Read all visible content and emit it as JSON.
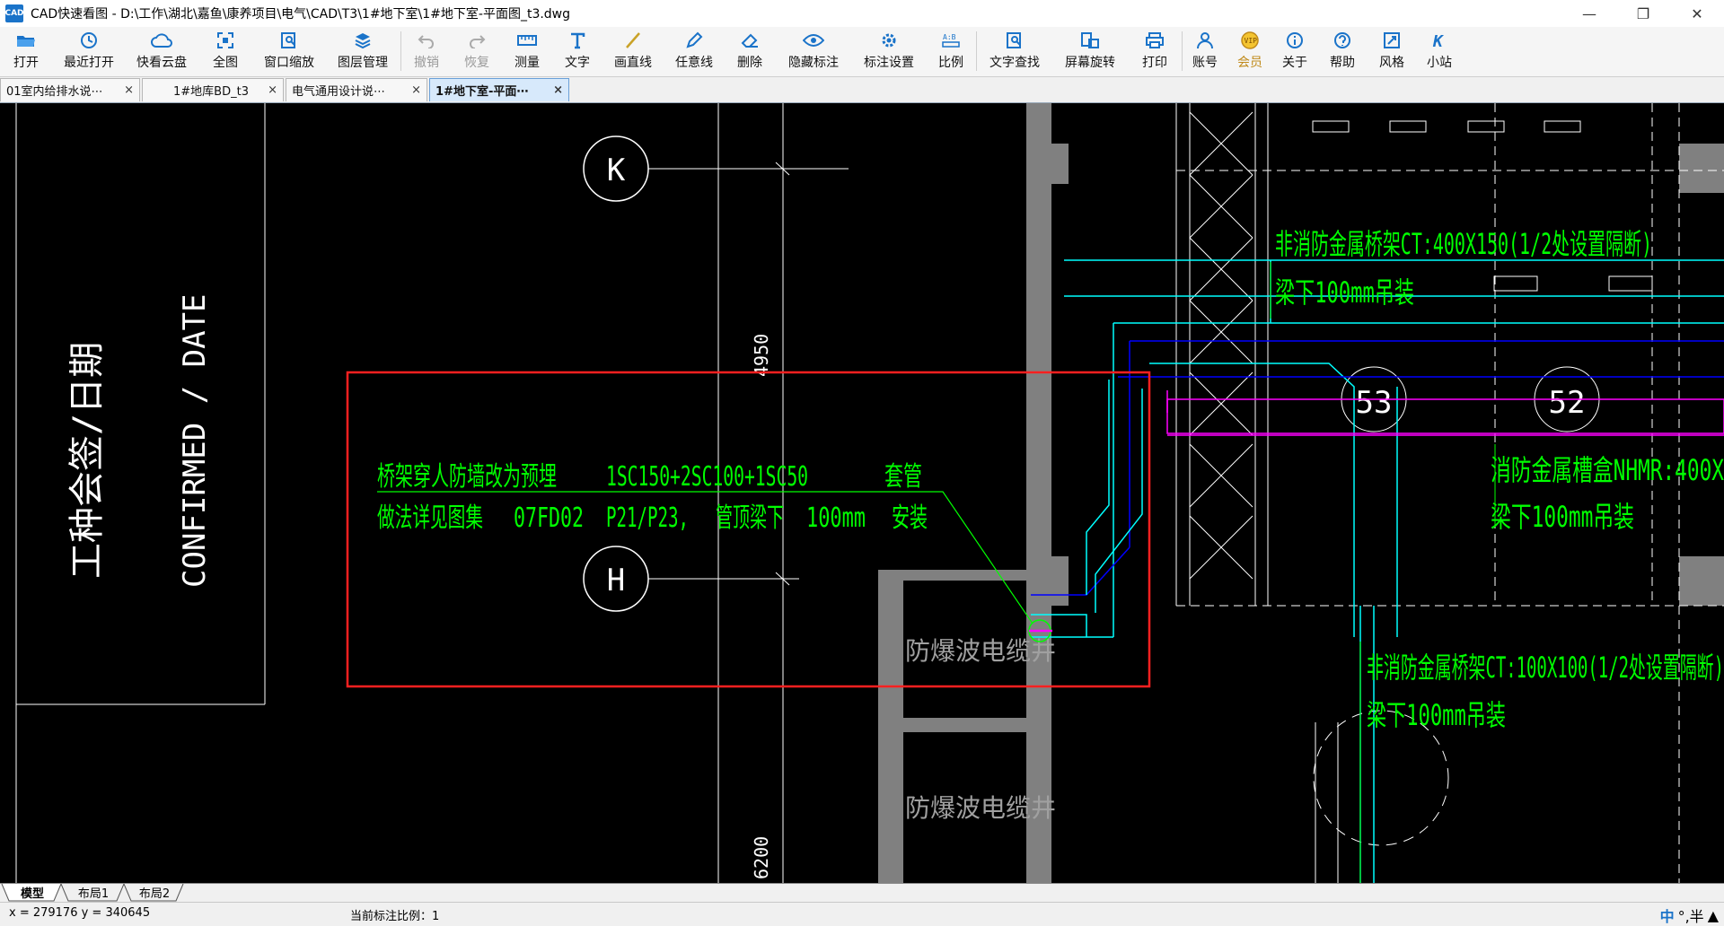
{
  "window": {
    "title": "CAD快速看图 - D:\\工作\\湖北\\嘉鱼\\康养项目\\电气\\CAD\\T3\\1#地下室\\1#地下室-平面图_t3.dwg",
    "app_icon_text": "CAD"
  },
  "toolbar": [
    {
      "label": "打开",
      "icon": "folder-open-icon"
    },
    {
      "label": "最近打开",
      "icon": "history-icon"
    },
    {
      "label": "快看云盘",
      "icon": "cloud-icon"
    },
    {
      "label": "全图",
      "icon": "fit-all-icon"
    },
    {
      "label": "窗口缩放",
      "icon": "zoom-window-icon"
    },
    {
      "label": "图层管理",
      "icon": "layers-icon"
    },
    {
      "label": "撤销",
      "icon": "undo-icon"
    },
    {
      "label": "恢复",
      "icon": "redo-icon"
    },
    {
      "label": "测量",
      "icon": "ruler-icon"
    },
    {
      "label": "文字",
      "icon": "text-icon"
    },
    {
      "label": "画直线",
      "icon": "line-icon"
    },
    {
      "label": "任意线",
      "icon": "pen-icon"
    },
    {
      "label": "删除",
      "icon": "eraser-icon"
    },
    {
      "label": "隐藏标注",
      "icon": "eye-icon"
    },
    {
      "label": "标注设置",
      "icon": "settings-icon"
    },
    {
      "label": "比例",
      "icon": "scale-icon"
    },
    {
      "label": "文字查找",
      "icon": "text-search-icon"
    },
    {
      "label": "屏幕旋转",
      "icon": "rotate-icon"
    },
    {
      "label": "打印",
      "icon": "printer-icon"
    },
    {
      "label": "账号",
      "icon": "user-icon"
    },
    {
      "label": "会员",
      "icon": "vip-icon"
    },
    {
      "label": "关于",
      "icon": "info-icon"
    },
    {
      "label": "帮助",
      "icon": "help-icon"
    },
    {
      "label": "风格",
      "icon": "style-icon"
    },
    {
      "label": "小站",
      "icon": "station-icon"
    }
  ],
  "tabs": [
    {
      "label": "01室内给排水说⋯",
      "close": "×"
    },
    {
      "label": "1#地库BD_t3",
      "close": "×"
    },
    {
      "label": "电气通用设计说⋯",
      "close": "×"
    },
    {
      "label": "1#地下室-平面⋯",
      "close": "×"
    }
  ],
  "layout_tabs": [
    "模型",
    "布局1",
    "布局2"
  ],
  "status": {
    "coords": "x = 279176 y = 340645",
    "scale": "当前标注比例：1",
    "ime_lang": "中",
    "ime_mode": "°,半"
  },
  "drawing": {
    "title_block_cn": "工种会签/日期",
    "title_block_en": "CONFIRMED / DATE",
    "grid_k": "K",
    "grid_h": "H",
    "grid_53": "53",
    "grid_52": "52",
    "dim_4950": "4950",
    "dim_6200": "6200",
    "note_line1_a": "桥架穿人防墙改为预埋",
    "note_line1_b": "1SC150+2SC100+1SC50",
    "note_line1_c": "套管",
    "note_line2_a": "做法详见图集",
    "note_line2_b": "07FD02",
    "note_line2_c": "P21/P23,",
    "note_line2_d": "管顶梁下",
    "note_line2_e": "100mm",
    "note_line2_f": "安装",
    "shaft_1": "防爆波电缆井",
    "shaft_2": "防爆波电缆井",
    "tray1_line1": "非消防金属桥架CT:400X150(1/2处设置隔断)",
    "tray1_line2": "梁下100mm吊装",
    "tray2_line1": "消防金属槽盒NHMR:400X",
    "tray2_line2": "梁下100mm吊装",
    "tray3_line1": "非消防金属桥架CT:100X100(1/2处设置隔断)",
    "tray3_line2": "梁下100mm吊装"
  },
  "colors": {
    "cad_green": "#00ff00",
    "cad_cyan": "#00ffff",
    "cad_blue": "#0000ff",
    "cad_magenta": "#ff00ff",
    "highlight_red": "#ff2020",
    "wall_gray": "#808080"
  }
}
